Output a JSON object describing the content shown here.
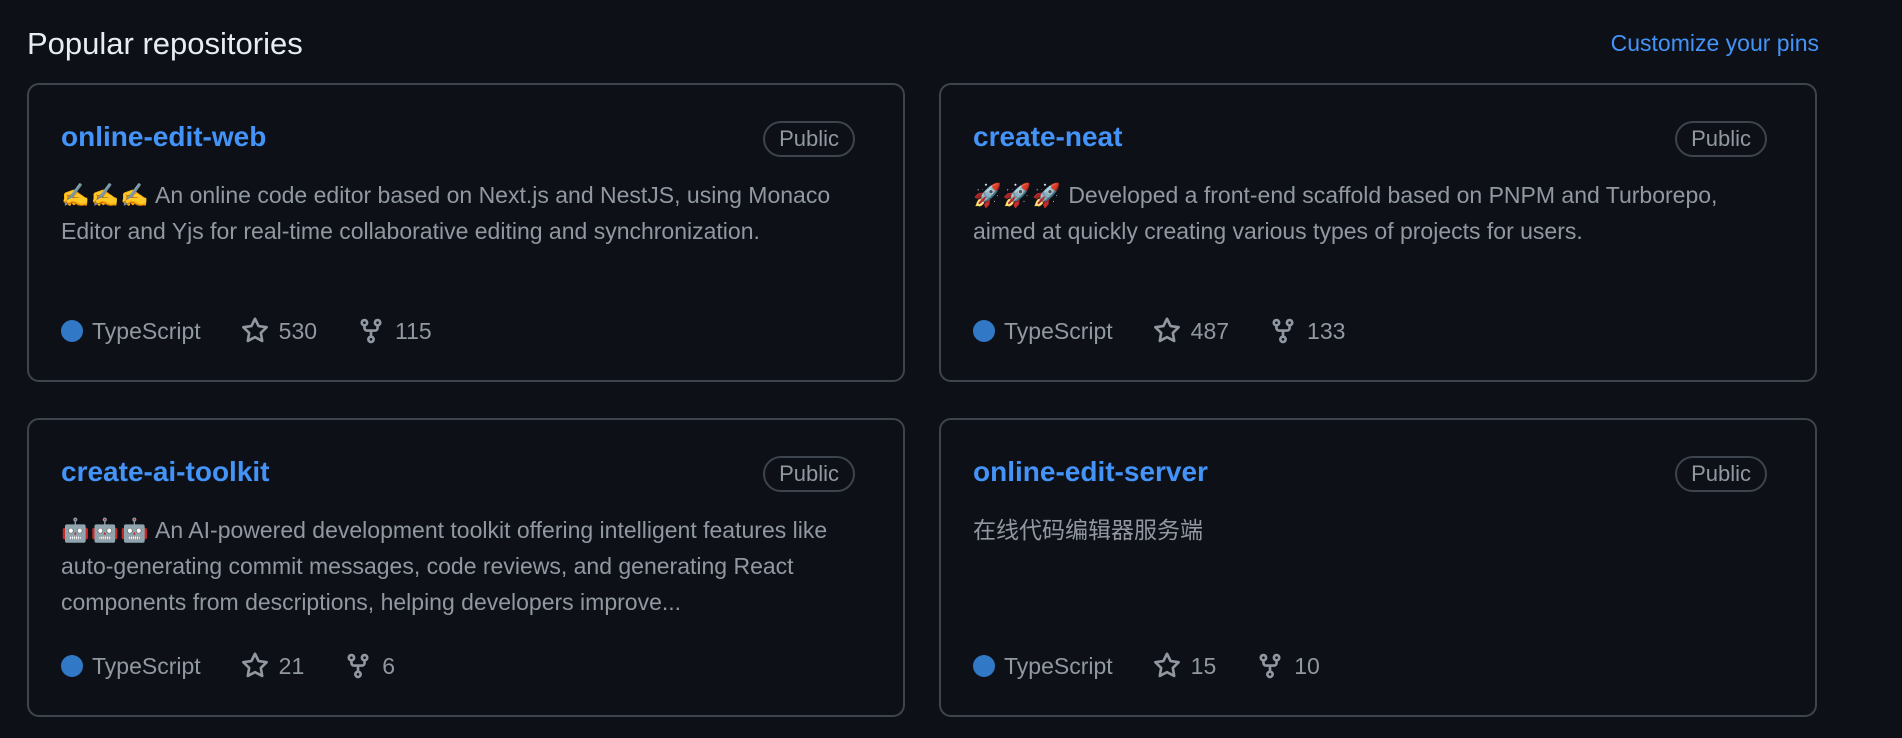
{
  "header": {
    "title": "Popular repositories",
    "customize_label": "Customize your pins"
  },
  "colors": {
    "background": "#0d1117",
    "accent": "#4493f8",
    "border": "#3d444d",
    "muted_text": "#9198a1",
    "typescript": "#3178c6"
  },
  "icons": {
    "language": "language-color-dot-icon",
    "stars": "star-icon",
    "forks": "repo-forked-icon"
  },
  "repos": [
    {
      "name": "online-edit-web",
      "visibility": "Public",
      "description_emoji": "✍️✍️✍️",
      "description": "An online code editor based on Next.js and NestJS, using Monaco Editor and Yjs for real-time collaborative editing and synchronization.",
      "language": "TypeScript",
      "stars": "530",
      "forks": "115"
    },
    {
      "name": "create-neat",
      "visibility": "Public",
      "description_emoji": "🚀🚀🚀",
      "description": "Developed a front-end scaffold based on PNPM and Turborepo, aimed at quickly creating various types of projects for users.",
      "language": "TypeScript",
      "stars": "487",
      "forks": "133"
    },
    {
      "name": "create-ai-toolkit",
      "visibility": "Public",
      "description_emoji": "🤖🤖🤖",
      "description": "An AI-powered development toolkit offering intelligent features like auto-generating commit messages, code reviews, and generating React components from descriptions, helping developers improve...",
      "language": "TypeScript",
      "stars": "21",
      "forks": "6"
    },
    {
      "name": "online-edit-server",
      "visibility": "Public",
      "description_emoji": "",
      "description": "在线代码编辑器服务端",
      "language": "TypeScript",
      "stars": "15",
      "forks": "10"
    }
  ]
}
